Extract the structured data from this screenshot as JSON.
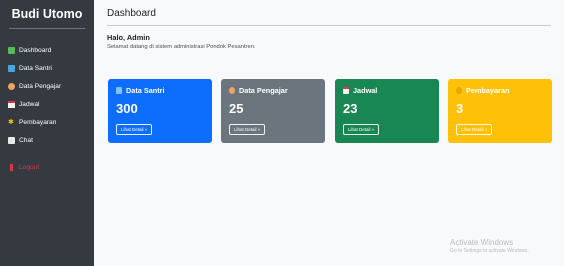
{
  "sidebar": {
    "brand": "Budi Utomo",
    "items": [
      {
        "label": "Dashboard",
        "icon": "dashboard-icon"
      },
      {
        "label": "Data Santri",
        "icon": "book-icon"
      },
      {
        "label": "Data Pengajar",
        "icon": "teacher-icon"
      },
      {
        "label": "Jadwal",
        "icon": "calendar-icon"
      },
      {
        "label": "Pembayaran",
        "icon": "coin-icon"
      },
      {
        "label": "Chat",
        "icon": "chat-icon"
      }
    ],
    "logout": "Logout"
  },
  "header": {
    "title": "Dashboard",
    "greeting": "Halo, Admin",
    "welcome": "Selamat datang di sistem administrasi Pondok Pesantren."
  },
  "cards": [
    {
      "title": "Data Santri",
      "value": "300",
      "button": "Lihat Detail »",
      "color": "#0d6efd",
      "icon": "book-icon"
    },
    {
      "title": "Data Pengajar",
      "value": "25",
      "button": "Lihat Detail »",
      "color": "#6c757d",
      "icon": "teacher-icon"
    },
    {
      "title": "Jadwal",
      "value": "23",
      "button": "Lihat Detail »",
      "color": "#198754",
      "icon": "calendar-icon"
    },
    {
      "title": "Pembayaran",
      "value": "3",
      "button": "Lihat Detail »",
      "color": "#ffc107",
      "icon": "coin-icon"
    }
  ],
  "watermark": {
    "title": "Activate Windows",
    "subtitle": "Go to Settings to activate Windows."
  }
}
